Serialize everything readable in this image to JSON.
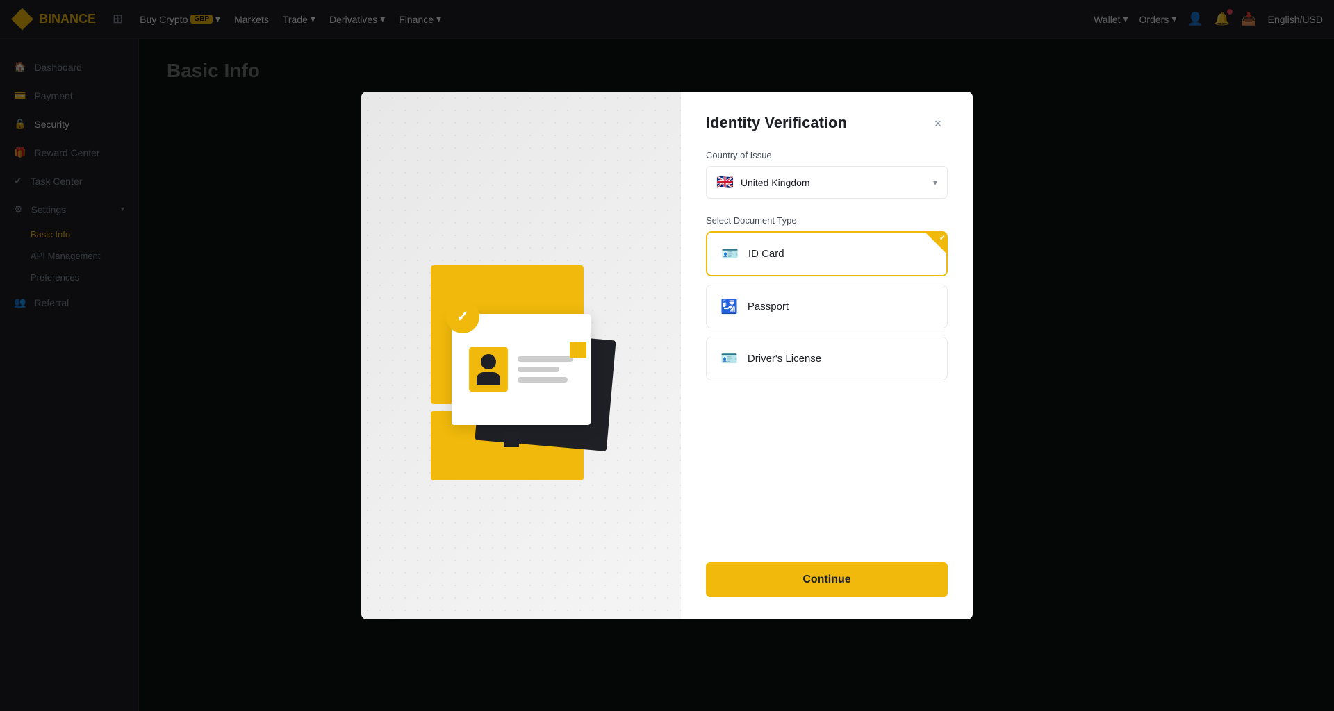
{
  "nav": {
    "logo_text": "BINANCE",
    "items": [
      {
        "label": "Buy Crypto",
        "badge": "GBP"
      },
      {
        "label": "Markets"
      },
      {
        "label": "Trade"
      },
      {
        "label": "Derivatives"
      },
      {
        "label": "Finance"
      }
    ],
    "right_items": [
      {
        "label": "Wallet"
      },
      {
        "label": "Orders"
      }
    ],
    "lang": "English/USD"
  },
  "sidebar": {
    "items": [
      {
        "label": "Dashboard",
        "icon": "🏠"
      },
      {
        "label": "Payment",
        "icon": "💳"
      },
      {
        "label": "Security",
        "icon": "🔒"
      },
      {
        "label": "Reward Center",
        "icon": "🎁"
      },
      {
        "label": "Task Center",
        "icon": "✓"
      },
      {
        "label": "Settings",
        "icon": "⚙"
      }
    ],
    "sub_items": [
      {
        "label": "Basic Info"
      },
      {
        "label": "API Management"
      },
      {
        "label": "Preferences"
      }
    ],
    "referral": {
      "label": "Referral",
      "icon": "👥"
    }
  },
  "main": {
    "page_title": "Basic Info"
  },
  "modal": {
    "title": "Identity Verification",
    "close_label": "×",
    "country_of_issue_label": "Country of Issue",
    "country": {
      "flag": "🇬🇧",
      "name": "United Kingdom"
    },
    "document_type_label": "Select Document Type",
    "documents": [
      {
        "id": "id-card",
        "label": "ID Card",
        "selected": true
      },
      {
        "id": "passport",
        "label": "Passport",
        "selected": false
      },
      {
        "id": "drivers-license",
        "label": "Driver's License",
        "selected": false
      }
    ],
    "continue_button": "Continue"
  }
}
